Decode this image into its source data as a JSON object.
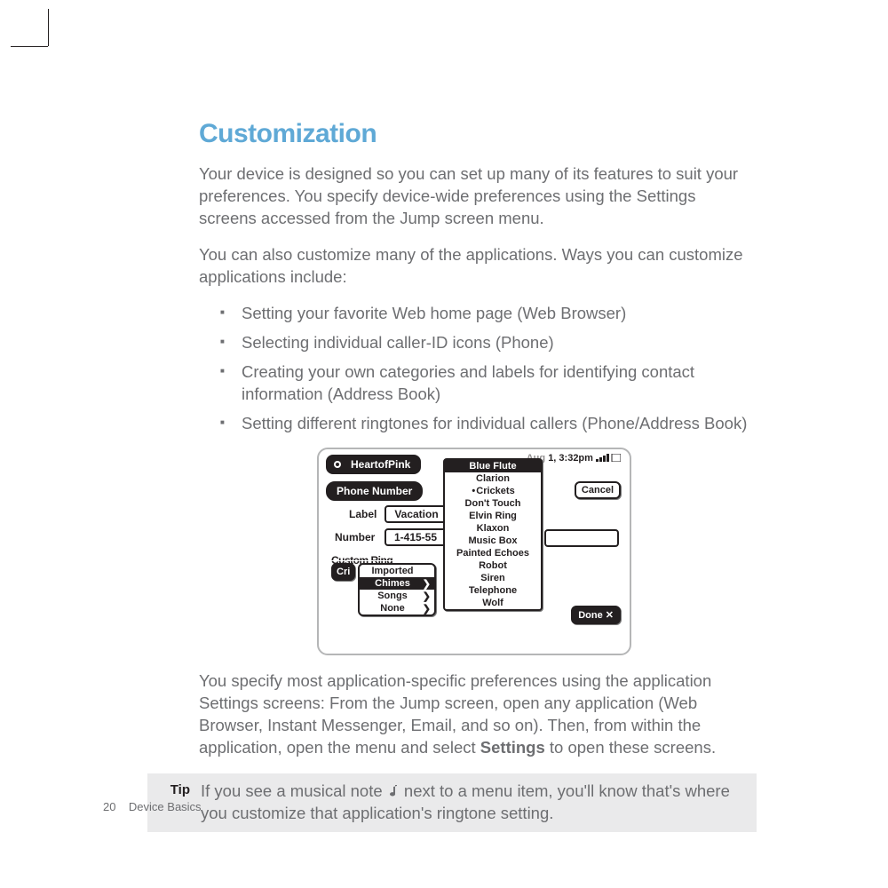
{
  "heading": "Customization",
  "para1": "Your device is designed so you can set up many of its features to suit your preferences. You specify device-wide preferences using the Settings screens accessed from the Jump screen menu.",
  "para2": "You can also customize many of the applications. Ways you can customize applications include:",
  "bullets": [
    "Setting your favorite Web home page (Web Browser)",
    "Selecting individual caller-ID icons (Phone)",
    "Creating your own categories and labels for identifying contact information (Address Book)",
    "Setting different ringtones for individual callers (Phone/Address Book)"
  ],
  "para3a": "You specify most application-specific preferences using the application Settings screens: From the Jump screen, open any application (Web Browser, Instant Messenger, Email, and so on). Then, from within the application, open the menu and select ",
  "para3b": "Settings",
  "para3c": " to open these screens.",
  "tip_label": "Tip",
  "tip_a": "If you see a musical note ",
  "tip_b": " next to a menu item, you'll know that's where you customize that application's ringtone setting.",
  "footer_page": "20",
  "footer_section": "Device Basics",
  "ui": {
    "title_tab": "HeartofPink",
    "section_tab": "Phone Number",
    "status_time": "1, 3:32pm",
    "label_text": "Label",
    "label_value": "Vacation",
    "number_text": "Number",
    "number_value": "1-415-55",
    "custom_ring": "Custom Ring",
    "cri_prefix": "Cri",
    "submenu": [
      "Imported",
      "Chimes",
      "Songs",
      "None"
    ],
    "ringtones": [
      "Blue Flute",
      "Clarion",
      "Crickets",
      "Don't Touch",
      "Elvin Ring",
      "Klaxon",
      "Music Box",
      "Painted Echoes",
      "Robot",
      "Siren",
      "Telephone",
      "Wolf"
    ],
    "cancel": "Cancel",
    "done": "Done ✕"
  }
}
